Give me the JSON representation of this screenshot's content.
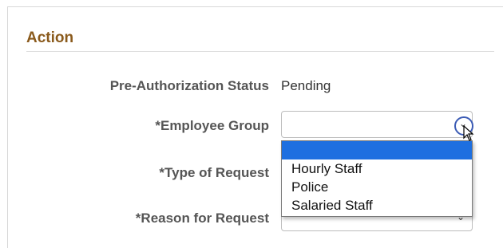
{
  "section": {
    "title": "Action"
  },
  "fields": {
    "pre_auth_status": {
      "label": "Pre-Authorization Status",
      "value": "Pending"
    },
    "employee_group": {
      "label": "*Employee Group",
      "value": "",
      "options": [
        "",
        "Hourly Staff",
        "Police",
        "Salaried Staff"
      ],
      "highlighted_option": ""
    },
    "type_of_request": {
      "label": "*Type of Request",
      "value": ""
    },
    "reason_for_request": {
      "label": "*Reason for Request",
      "value": ""
    }
  },
  "icons": {
    "dropdown_chevron": "chevron-down-icon",
    "cursor": "mouse-pointer-icon"
  },
  "colors": {
    "section_title": "#8a5a1c",
    "highlight": "#1e6fe0",
    "focus_ring": "#3b5bb5"
  }
}
